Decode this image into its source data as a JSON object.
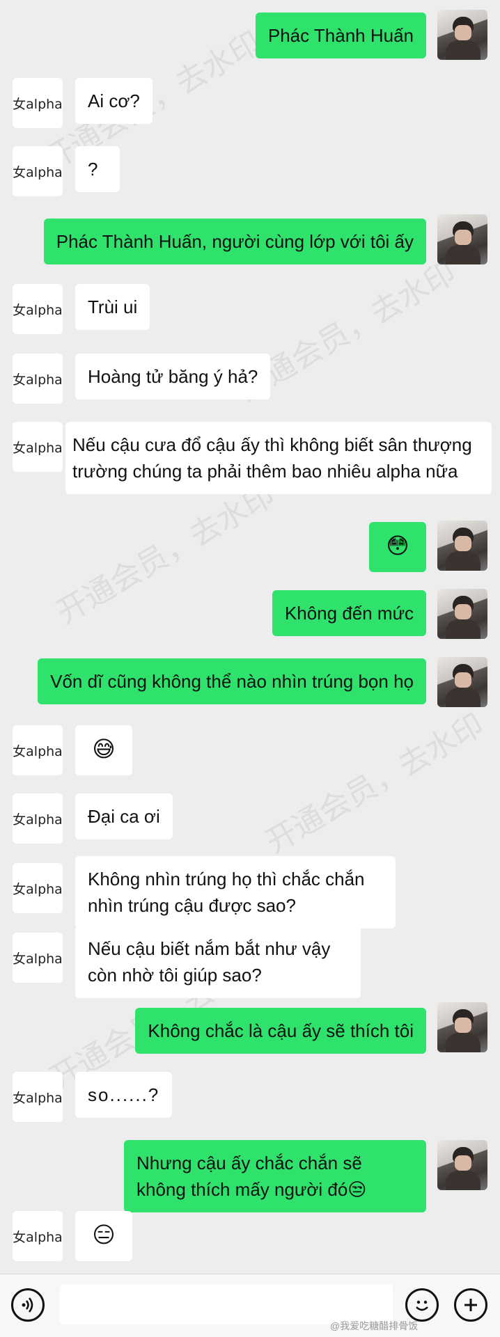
{
  "contact": {
    "avatar_label": "女alpha"
  },
  "messages": [
    {
      "side": "right",
      "text": "Phác Thành Huấn"
    },
    {
      "side": "left",
      "text": "Ai cơ?"
    },
    {
      "side": "left",
      "text": "?"
    },
    {
      "side": "right",
      "text": "Phác Thành Huấn, người cùng lớp với tôi ấy"
    },
    {
      "side": "left",
      "text": "Trùi ui"
    },
    {
      "side": "left",
      "text": "Hoàng tử băng ý hả?"
    },
    {
      "side": "left",
      "text": "Nếu cậu cưa đổ cậu ấy thì không biết sân thượng trường chúng ta phải thêm bao nhiêu alpha nữa"
    },
    {
      "side": "right",
      "text": "😳"
    },
    {
      "side": "right",
      "text": "Không đến mức"
    },
    {
      "side": "right",
      "text": "Vốn dĩ cũng không thể nào nhìn trúng bọn họ"
    },
    {
      "side": "left",
      "text": "😅"
    },
    {
      "side": "left",
      "text": "Đại ca ơi"
    },
    {
      "side": "left",
      "text": "Không nhìn trúng họ thì chắc chắn nhìn trúng cậu được sao?"
    },
    {
      "side": "left",
      "text": "Nếu cậu biết nắm bắt như vậy còn nhờ tôi giúp sao?"
    },
    {
      "side": "right",
      "text": "Không chắc là cậu ấy sẽ thích tôi"
    },
    {
      "side": "left",
      "text": "so......?"
    },
    {
      "side": "right",
      "text": "Nhưng cậu ấy chắc chắn sẽ không thích mấy người đó😒"
    },
    {
      "side": "left",
      "text": "😑"
    }
  ],
  "watermark": {
    "text": "开通会员，去水印"
  },
  "footer": {
    "credit": "@我爱吃糖醋排骨饭"
  },
  "toolbar": {
    "voice_icon": "voice-icon",
    "emoji_icon": "emoji-icon",
    "plus_icon": "plus-icon"
  },
  "colors": {
    "sent_bubble": "#2fe26b",
    "received_bubble": "#ffffff",
    "background": "#ededed"
  }
}
